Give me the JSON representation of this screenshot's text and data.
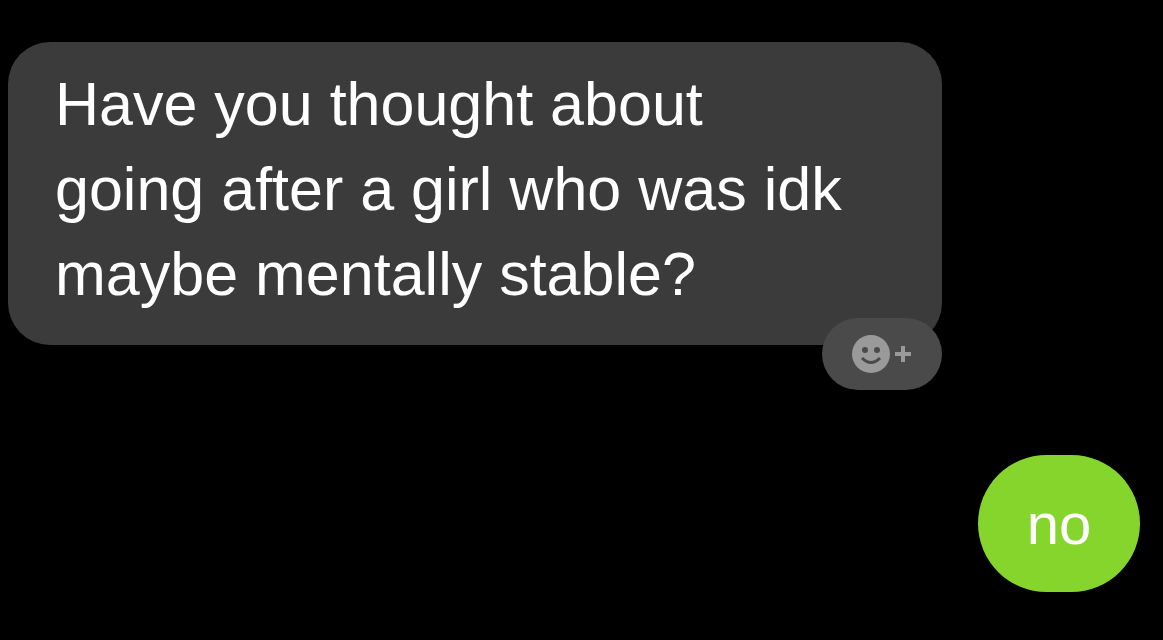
{
  "messages": [
    {
      "kind": "received",
      "text": "Have you thought about\ngoing after a girl who was idk\nmaybe mentally stable?"
    },
    {
      "kind": "sent",
      "text": "no"
    }
  ]
}
